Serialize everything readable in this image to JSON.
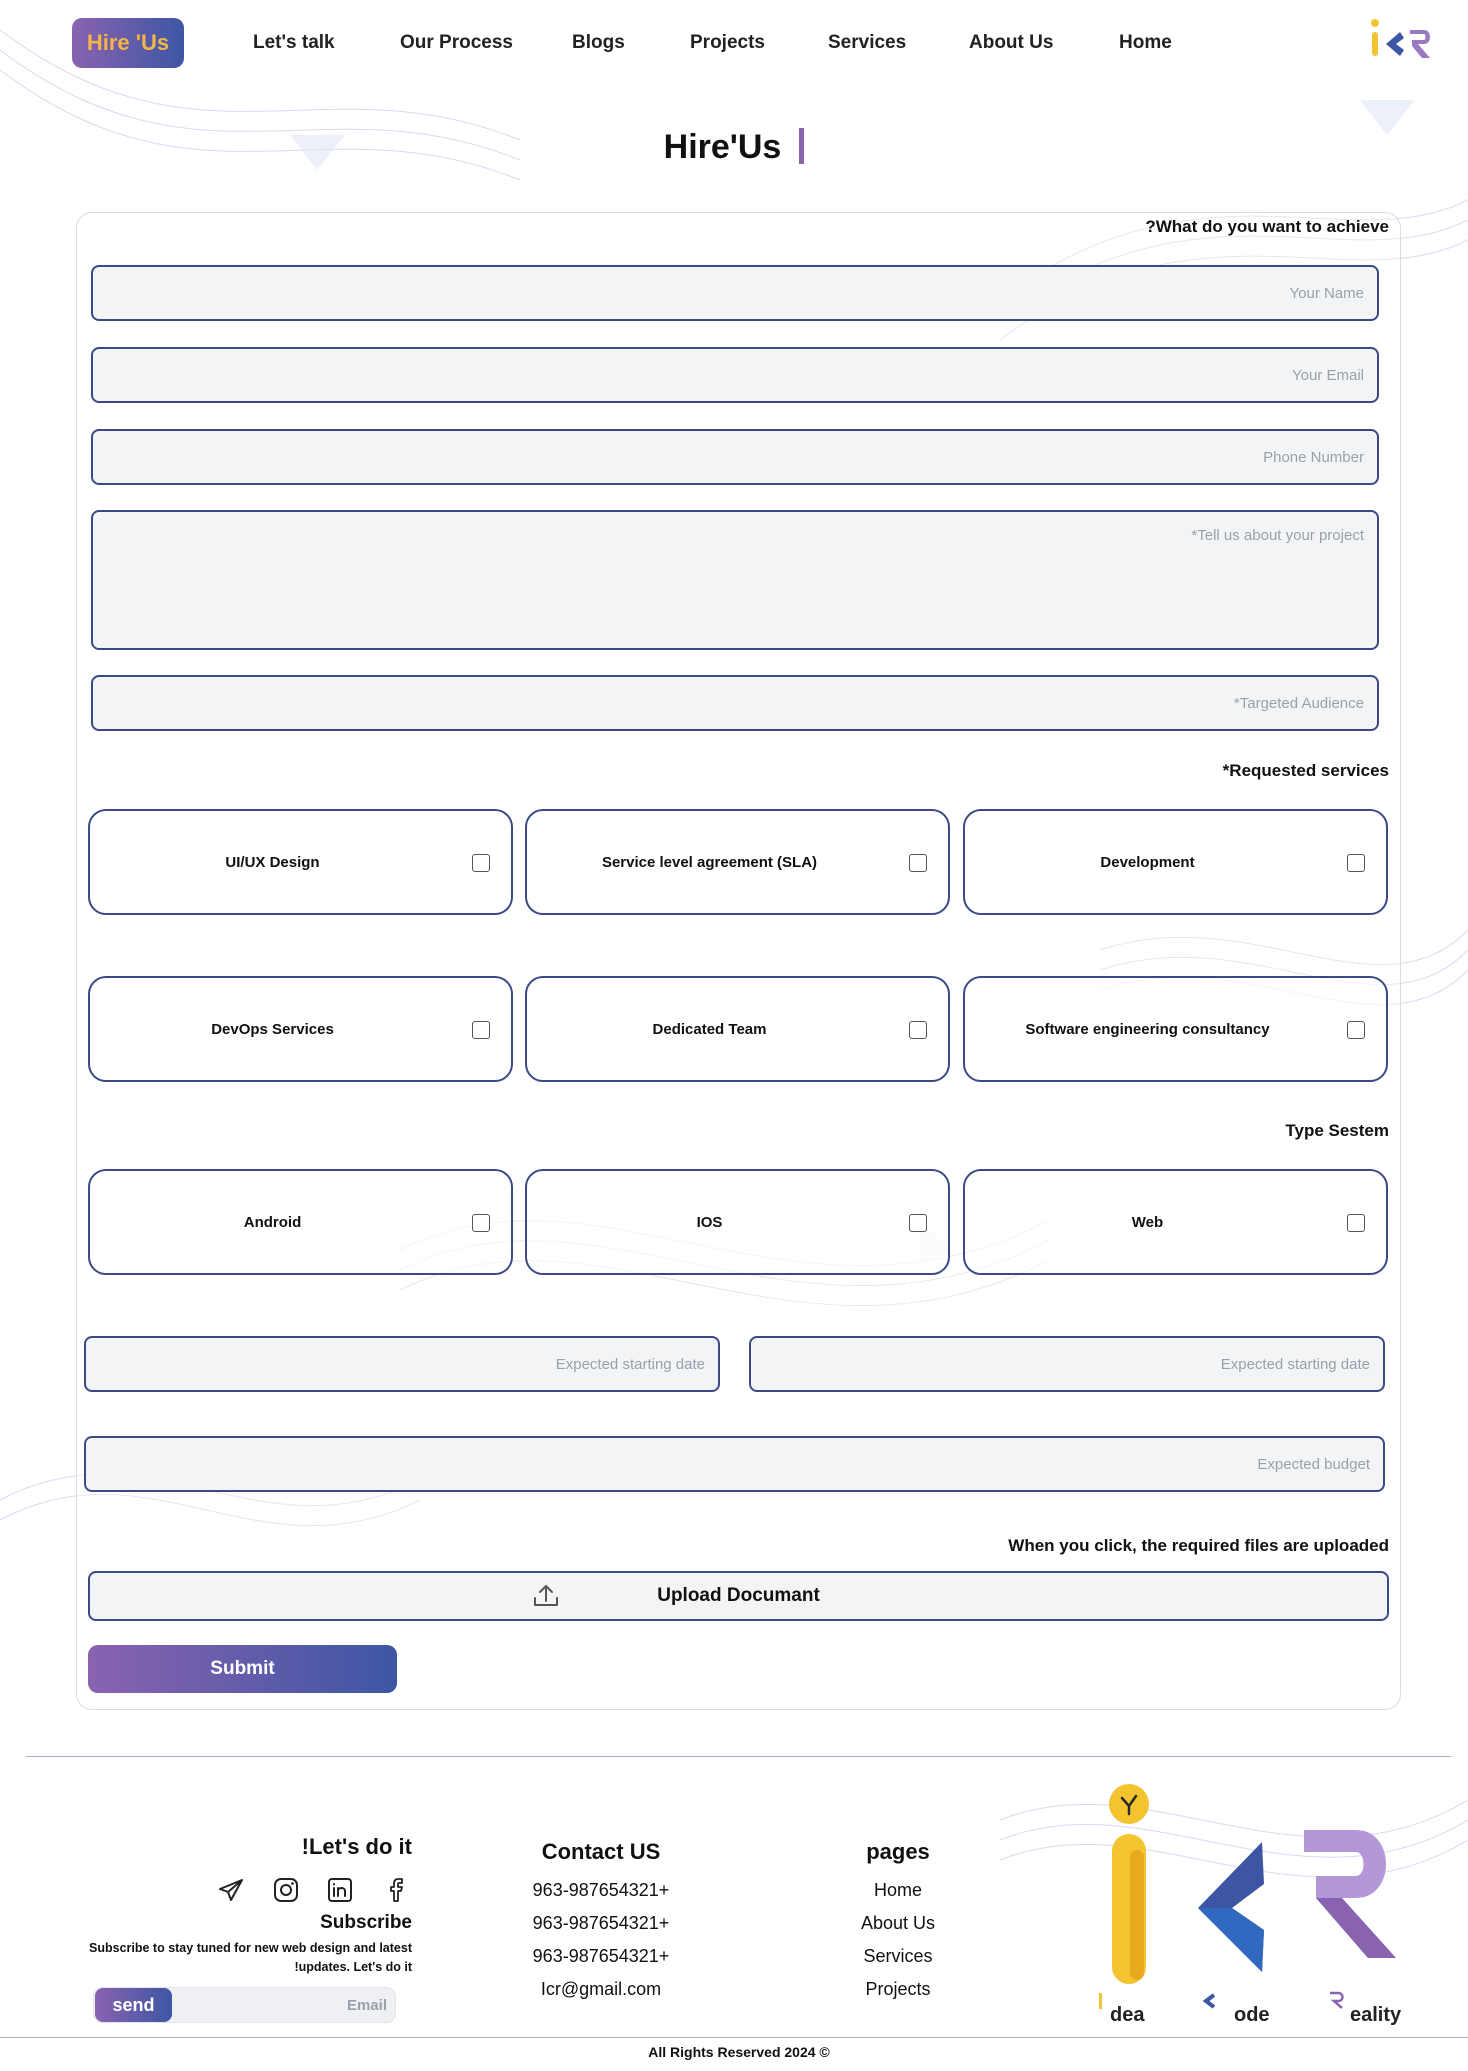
{
  "nav": {
    "hire_button": "Hire 'Us",
    "links": [
      "Let's talk",
      "Our Process",
      "Blogs",
      "Projects",
      "Services",
      "About Us",
      "Home"
    ]
  },
  "page_title": "Hire'Us",
  "form": {
    "achieve_label": "?What do you want to achieve",
    "name_placeholder": "Your Name",
    "email_placeholder": "Your Email",
    "phone_placeholder": "Phone Number",
    "project_placeholder": "*Tell us about your project",
    "audience_placeholder": "*Targeted Audience",
    "services_label": "*Requested services",
    "services": [
      "UI/UX Design",
      "Service level agreement (SLA)",
      "Development",
      "DevOps Services",
      "Dedicated Team",
      "Software engineering consultancy"
    ],
    "system_label": "Type Sestem",
    "systems": [
      "Android",
      "IOS",
      "Web"
    ],
    "start_date_placeholder": "Expected starting date",
    "start_date2_placeholder": "Expected starting date",
    "budget_placeholder": "Expected budget",
    "upload_note": "When you click, the required files are uploaded",
    "upload_label": "Upload Documant",
    "submit_label": "Submit"
  },
  "footer": {
    "lets_do_it": "!Let's do it",
    "subscribe_title": "Subscribe",
    "subscribe_text_1": "Subscribe to stay tuned for new web design and latest",
    "subscribe_text_2": "!updates. Let's do it",
    "send_label": "send",
    "email_placeholder": "Email",
    "contact_title": "Contact US",
    "phones": [
      "963-987654321+",
      "963-987654321+",
      "963-987654321+"
    ],
    "email": "Icr@gmail.com",
    "pages_title": "pages",
    "pages": [
      "Home",
      "About Us",
      "Services",
      "Projects"
    ],
    "logo_captions": [
      "dea",
      "ode",
      "eality"
    ],
    "copyright": "All Rights Reserved 2024 ©"
  },
  "colors": {
    "accent_purple": "#8a63b0",
    "accent_blue": "#3d56a4",
    "accent_yellow": "#f2b646",
    "field_border": "#3b4a86"
  }
}
